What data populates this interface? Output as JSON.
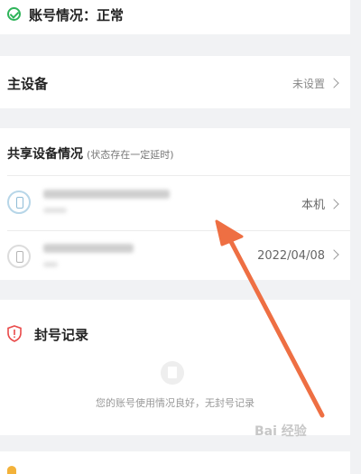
{
  "account_status": {
    "text": "账号情况：正常"
  },
  "main_device": {
    "label": "主设备",
    "value": "未设置"
  },
  "shared_devices": {
    "title": "共享设备情况",
    "note": "(状态存在一定延时)",
    "devices": [
      {
        "right_text": "本机",
        "icon": "phone-icon",
        "highlight": true
      },
      {
        "right_text": "2022/04/08",
        "icon": "phone-icon",
        "highlight": false
      }
    ]
  },
  "ban_record": {
    "title": "封号记录",
    "message": "您的账号使用情况良好，无封号记录"
  },
  "colors": {
    "accent_green": "#2fb45a",
    "arrow": "#ee6f43",
    "warning_red": "#e94b4b",
    "background_gray": "#f1f2f4"
  }
}
